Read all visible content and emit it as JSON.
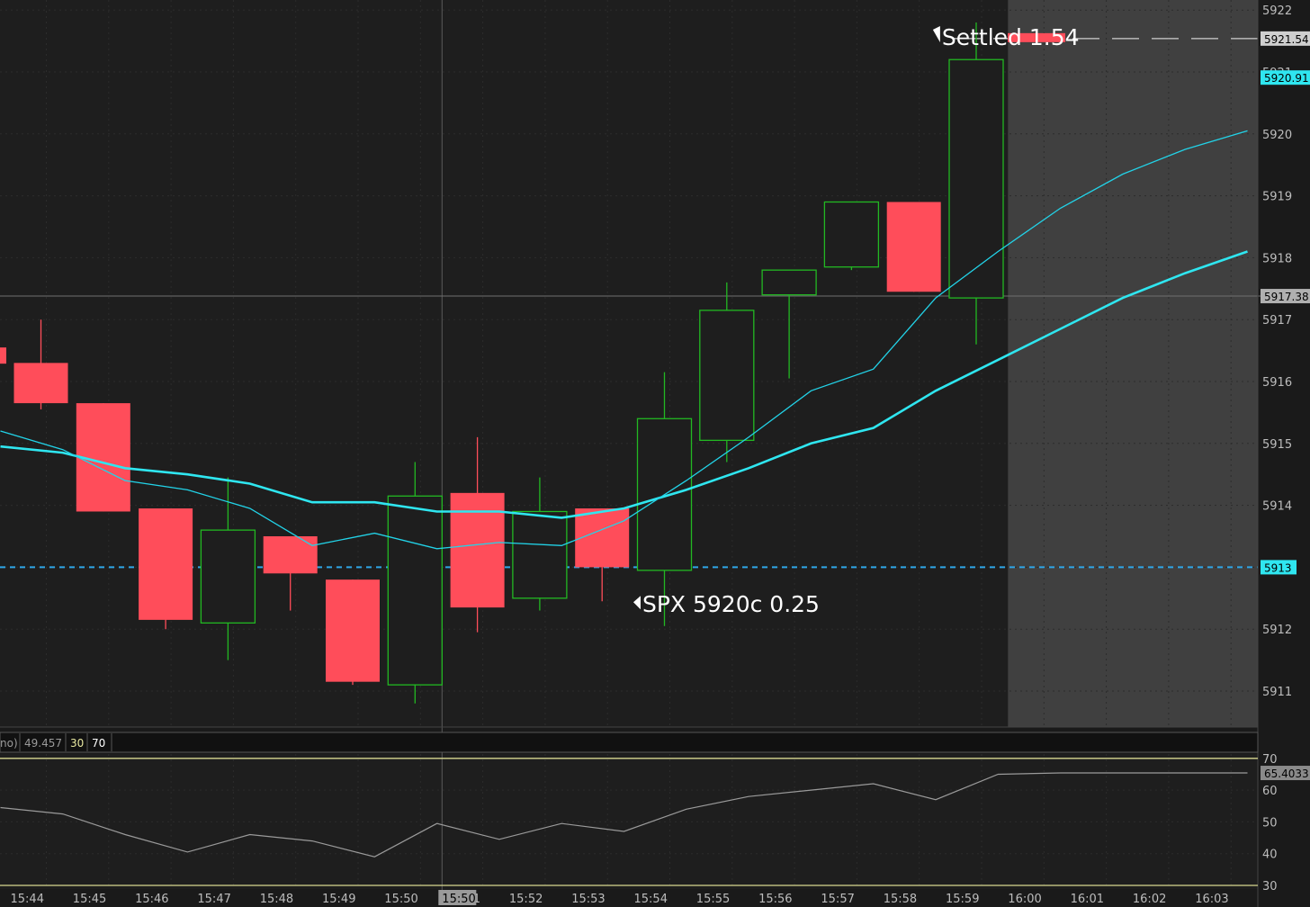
{
  "chart_data": [
    {
      "type": "candlestick",
      "title": "",
      "x_labels": [
        "15:44",
        "15:45",
        "15:46",
        "15:47",
        "15:48",
        "15:49",
        "15:50",
        "15:51",
        "15:52",
        "15:53",
        "15:54",
        "15:55",
        "15:56",
        "15:57",
        "15:58",
        "15:59",
        "16:00",
        "16:01",
        "16:02",
        "16:03"
      ],
      "ylim": [
        5910.4,
        5922.1
      ],
      "y_ticks": [
        5911,
        5912,
        5913,
        5914,
        5915,
        5916,
        5917,
        5918,
        5919,
        5920,
        5921,
        5922
      ],
      "candles": [
        {
          "time": "15:44",
          "open": 5916.3,
          "high": 5917.0,
          "low": 5915.55,
          "close": 5915.65
        },
        {
          "time": "15:45",
          "open": 5915.65,
          "high": 5915.65,
          "low": 5913.9,
          "close": 5913.9
        },
        {
          "time": "15:46",
          "open": 5913.95,
          "high": 5913.95,
          "low": 5912.0,
          "close": 5912.15
        },
        {
          "time": "15:47",
          "open": 5912.1,
          "high": 5914.45,
          "low": 5911.5,
          "close": 5913.6
        },
        {
          "time": "15:48",
          "open": 5913.5,
          "high": 5913.5,
          "low": 5912.3,
          "close": 5912.9
        },
        {
          "time": "15:49",
          "open": 5912.8,
          "high": 5912.8,
          "low": 5911.1,
          "close": 5911.15
        },
        {
          "time": "15:50",
          "open": 5911.1,
          "high": 5914.7,
          "low": 5910.8,
          "close": 5914.15
        },
        {
          "time": "15:51",
          "open": 5914.2,
          "high": 5915.1,
          "low": 5911.95,
          "close": 5912.35
        },
        {
          "time": "15:52",
          "open": 5912.5,
          "high": 5914.45,
          "low": 5912.3,
          "close": 5913.9
        },
        {
          "time": "15:53",
          "open": 5913.95,
          "high": 5913.95,
          "low": 5912.45,
          "close": 5913.0
        },
        {
          "time": "15:54",
          "open": 5912.95,
          "high": 5916.15,
          "low": 5912.05,
          "close": 5915.4
        },
        {
          "time": "15:55",
          "open": 5915.05,
          "high": 5917.6,
          "low": 5914.7,
          "close": 5917.15
        },
        {
          "time": "15:56",
          "open": 5917.4,
          "high": 5917.4,
          "low": 5916.05,
          "close": 5917.8
        },
        {
          "time": "15:57",
          "open": 5917.85,
          "high": 5918.9,
          "low": 5917.8,
          "close": 5918.9
        },
        {
          "time": "15:58",
          "open": 5918.9,
          "high": 5918.9,
          "low": 5917.45,
          "close": 5917.45
        },
        {
          "time": "15:59",
          "open": 5917.35,
          "high": 5921.8,
          "low": 5916.6,
          "close": 5921.2
        }
      ],
      "series": [
        {
          "name": "",
          "color": "#2fe6f0",
          "values": [
            5914.95,
            5914.85,
            5914.6,
            5914.5,
            5914.35,
            5914.05,
            5914.05,
            5913.9,
            5913.9,
            5913.8,
            5913.95,
            5914.25,
            5914.6,
            5915.0,
            5915.25,
            5915.85,
            5916.35,
            5916.85,
            5917.35,
            5917.75,
            5918.1
          ]
        },
        {
          "name": "",
          "color": "#22d3e8",
          "values": [
            5915.2,
            5914.9,
            5914.4,
            5914.25,
            5913.95,
            5913.35,
            5913.55,
            5913.3,
            5913.4,
            5913.35,
            5913.75,
            5914.4,
            5915.1,
            5915.85,
            5916.2,
            5917.35,
            5918.1,
            5918.8,
            5919.35,
            5919.75,
            5920.05
          ]
        }
      ],
      "annotations": [
        {
          "text": "Settled 1.54",
          "time_index": 15.2
        },
        {
          "text": "SPX 5920c 0.25",
          "time_index": 10.05,
          "y": 5912.45
        }
      ],
      "price_labels": [
        {
          "text": "5921.54",
          "value": 5921.54,
          "color": "#cfcfcf",
          "fg": "#000000"
        },
        {
          "text": "5920.91",
          "value": 5920.91,
          "color": "#2fe6f0",
          "fg": "#000000"
        },
        {
          "text": "5917.38",
          "value": 5917.38,
          "color": "#b0b0b0",
          "fg": "#000000"
        },
        {
          "text": "5913",
          "value": 5913.0,
          "color": "#2fe6f0",
          "fg": "#000000"
        }
      ],
      "reference_lines": [
        {
          "value": 5917.38,
          "style": "solid",
          "color": "#707070"
        },
        {
          "value": 5913.0,
          "style": "dashed",
          "color": "#2fa7e8"
        },
        {
          "value": 5921.54,
          "style": "dashed",
          "color": "#d0d0d0"
        }
      ],
      "crosshair_time": "15:50",
      "grid": true,
      "future_shading_from": "16:00"
    },
    {
      "type": "line",
      "title": "",
      "header_values": [
        "no)",
        "49.457",
        "30",
        "70"
      ],
      "ylim": [
        30,
        70
      ],
      "y_ticks": [
        30,
        40,
        50,
        60,
        70
      ],
      "overbought": 70,
      "oversold": 30,
      "current_label": "65.4033",
      "series": [
        {
          "name": "",
          "color": "#9a9a9a",
          "values": [
            54.5,
            52.5,
            46.0,
            40.5,
            46.0,
            44.0,
            39.0,
            49.5,
            44.5,
            49.5,
            47.0,
            54.0,
            58.0,
            60.0,
            62.0,
            57.0,
            65.0,
            65.4033,
            65.4033,
            65.4033,
            65.4033
          ]
        }
      ],
      "grid": true
    }
  ],
  "axis": {
    "time_labels": [
      "15:44",
      "15:45",
      "15:46",
      "15:47",
      "15:48",
      "15:49",
      "15:50",
      "15:51",
      "15:52",
      "15:53",
      "15:54",
      "15:55",
      "15:56",
      "15:57",
      "15:58",
      "15:59",
      "16:00",
      "16:01",
      "16:02",
      "16:03"
    ],
    "crosshair_label": "15:50"
  }
}
